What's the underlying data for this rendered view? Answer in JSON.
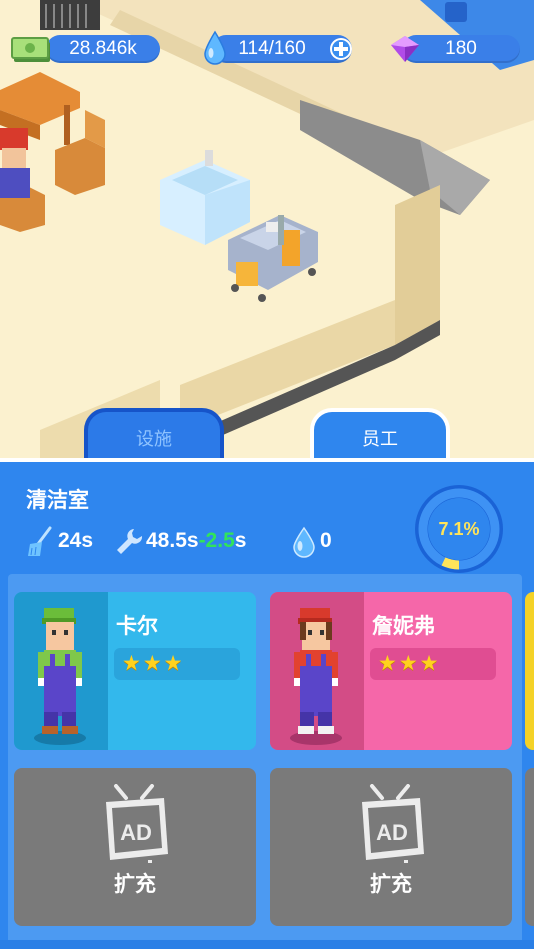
{
  "resources": {
    "money": "28.846k",
    "water": "114/160",
    "gems": "180"
  },
  "tabs": {
    "facilities": "设施",
    "staff": "员工"
  },
  "room": {
    "title": "清洁室",
    "clean_time": "24s",
    "repair_time": "48.5s",
    "repair_bonus": "-2.5",
    "repair_bonus_unit": "s",
    "water_use": "0",
    "progress_label": "7.1%",
    "progress_value": 0.071
  },
  "staff": [
    {
      "name": "卡尔",
      "stars": 3,
      "color": "#33b8ec"
    },
    {
      "name": "詹妮弗",
      "stars": 3,
      "color": "#f567a9"
    }
  ],
  "expand_slots": [
    {
      "label": "扩充",
      "icon": "ad-tv-icon",
      "badge": "AD"
    },
    {
      "label": "扩充",
      "icon": "ad-tv-icon",
      "badge": "AD"
    }
  ],
  "colors": {
    "panel": "#2f86ee",
    "progress_ring": "#ffe45a",
    "bonus": "#31e35b"
  }
}
